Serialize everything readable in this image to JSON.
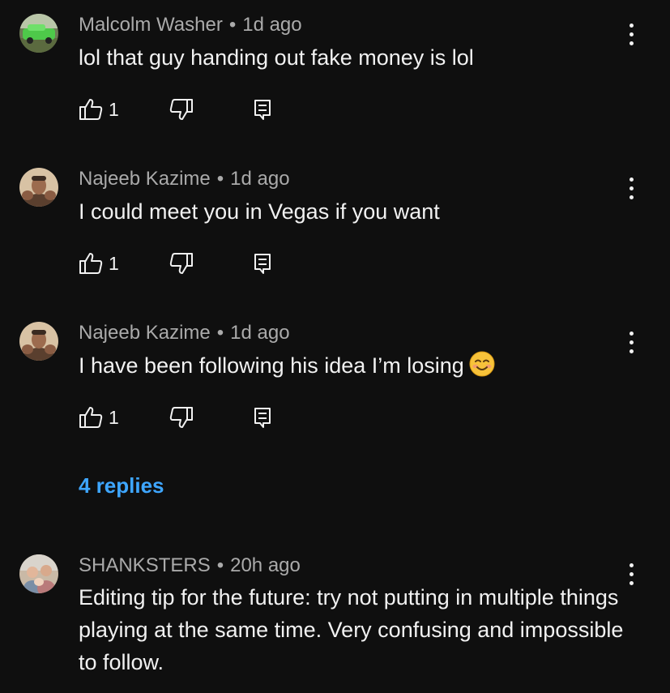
{
  "comments": [
    {
      "author": "Malcolm Washer",
      "time": "1d ago",
      "text": "lol that guy handing out fake money is lol",
      "likes": "1"
    },
    {
      "author": "Najeeb Kazime",
      "time": "1d ago",
      "text": "I could meet you in Vegas if you want",
      "likes": "1"
    },
    {
      "author": "Najeeb Kazime",
      "time": "1d ago",
      "text": "I have been following his idea I’m losing",
      "likes": "1",
      "emoji": "smiling-face-emoji"
    },
    {
      "author": "SHANKSTERS",
      "time": "20h ago",
      "text": "Editing tip for the future: try not putting in multiple things playing at the same time. Very confusing and impossible to follow."
    }
  ],
  "separator": "•",
  "replies_link": "4 replies",
  "colors": {
    "background": "#0f0f0f",
    "text": "#f1f1f1",
    "meta": "#aaaaaa",
    "link": "#3ea6ff"
  },
  "icons": [
    "like-icon",
    "dislike-icon",
    "reply-icon",
    "more-options-icon"
  ]
}
